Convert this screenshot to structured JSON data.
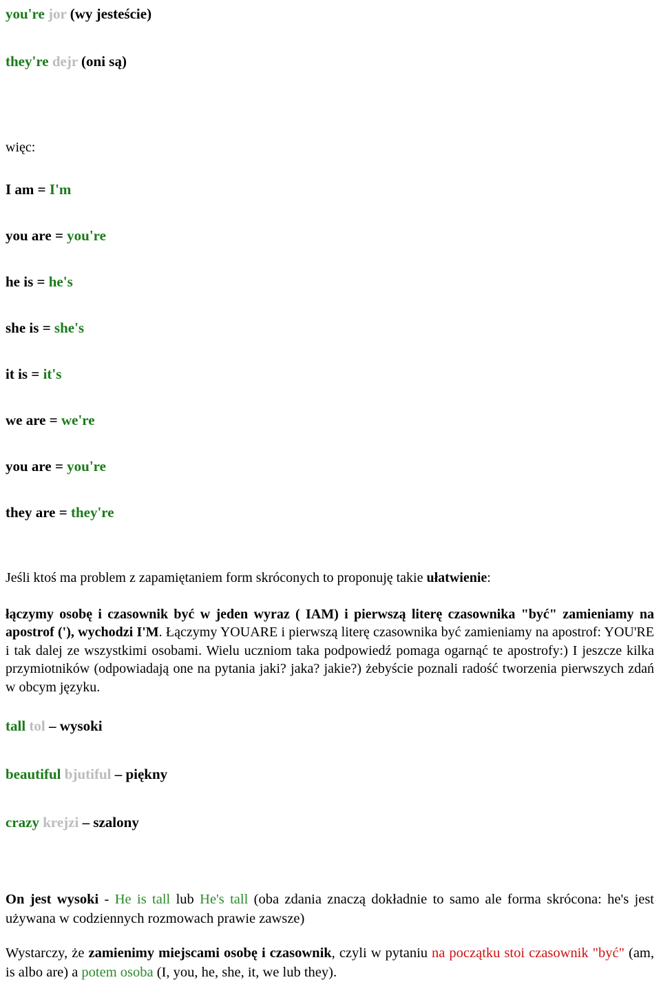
{
  "document": {
    "topic": "Angielskie formy skrócone (contractions) i przymiotniki",
    "colors": {
      "english_green": "#1a7a1a",
      "pronunciation_gray": "#bcbcbc",
      "polish_black": "#000000",
      "highlight_red": "#cc1111",
      "highlight_green": "#2a8a2a"
    }
  },
  "vocab_lines": [
    {
      "english": "you're",
      "pronunciation": "jor",
      "polish": "(wy jesteście)"
    },
    {
      "english": "they're",
      "pronunciation": "dejr",
      "polish": "(oni są)"
    }
  ],
  "wiec_label": "więc:",
  "contractions": [
    {
      "full": "I am",
      "eq": "=",
      "short": "I'm"
    },
    {
      "full": "you are",
      "eq": "=",
      "short": "you're"
    },
    {
      "full": "he is",
      "eq": "=",
      "short": "he's"
    },
    {
      "full": "she is",
      "eq": "=",
      "short": "she's"
    },
    {
      "full": "it is",
      "eq": "=",
      "short": "it's"
    },
    {
      "full": "we are",
      "eq": "=",
      "short": "we're"
    },
    {
      "full": "you are",
      "eq": "=",
      "short": "you're"
    },
    {
      "full": "they are",
      "eq": "=",
      "short": "they're"
    }
  ],
  "intro_paragraph": {
    "normal_1": "Jeśli ktoś ma problem z zapamiętaniem form skróconych to proponuję takie ",
    "bold_1": "ułatwienie",
    "normal_2": ":"
  },
  "explanation": {
    "bold_1": "łączymy osobę i czasownik być w jeden wyraz ( IAM) i pierwszą literę czasownika \"być\" zamieniamy na apostrof ('), wychodzi I'M",
    "normal_1": ". Łączymy YOUARE i pierwszą literę czasownika być zamieniamy na apostrof: YOU'RE i tak dalej ze wszystkimi osobami. Wielu uczniom taka podpowiedź pomaga ogarnąć te apostrofy:) I jeszcze kilka przymiotników (odpowiadają one na pytania jaki? jaka? jakie?) żebyście poznali radość tworzenia pierwszych zdań w obcym języku."
  },
  "adjectives": [
    {
      "english": "tall",
      "pronunciation": "tol",
      "dash": "–",
      "polish": "wysoki"
    },
    {
      "english": "beautiful",
      "pronunciation": "bjutiful",
      "dash": "–",
      "polish": "piękny"
    },
    {
      "english": "crazy",
      "pronunciation": "krejzi",
      "dash": "–",
      "polish": "szalony"
    }
  ],
  "example_paragraph": {
    "bold_pl": "On jest wysoki",
    "dash": " - ",
    "green_1": "He is tall",
    "mid": " lub ",
    "green_2": "He's tall",
    "rest": " (oba zdania znaczą dokładnie to samo ale forma skrócona: he's jest używana w codziennych rozmowach prawie zawsze)"
  },
  "rule_paragraph": {
    "normal_1": "Wystarczy, że ",
    "bold_1": "zamienimy miejscami osobę i czasownik",
    "normal_2": ", czyli w pytaniu ",
    "red_1": "na początku stoi czasownik \"być\"",
    "normal_3": " (am, is albo are) a ",
    "green_1": "potem osoba",
    "normal_4": " (I, you, he, she, it, we lub they)."
  }
}
